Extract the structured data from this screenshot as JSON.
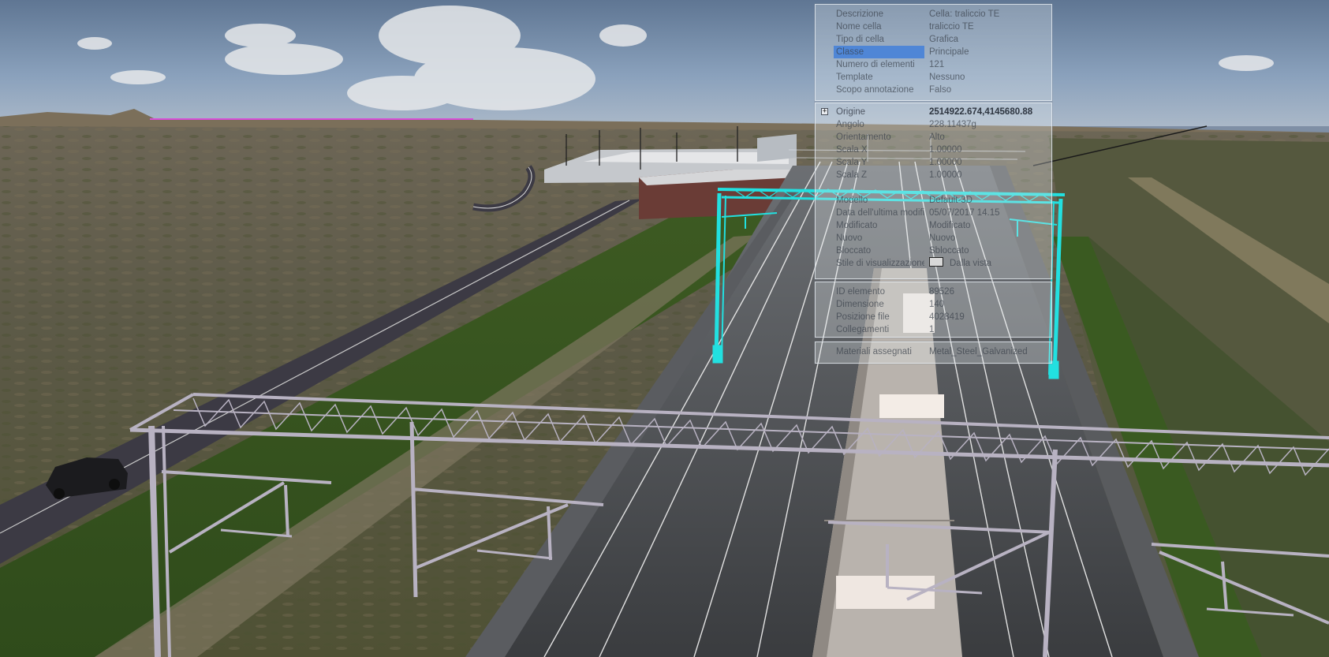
{
  "app": {
    "view": "3D viewport"
  },
  "info_panel": {
    "general": [
      {
        "label": "Descrizione",
        "value": "Cella: traliccio TE"
      },
      {
        "label": "Nome cella",
        "value": "traliccio TE"
      },
      {
        "label": "Tipo di cella",
        "value": "Grafica"
      },
      {
        "label": "Classe",
        "value": "Principale"
      },
      {
        "label": "Numero di elementi",
        "value": "121"
      },
      {
        "label": "Template",
        "value": "Nessuno"
      },
      {
        "label": "Scopo annotazione",
        "value": "Falso"
      }
    ],
    "geometry": [
      {
        "label": "Origine",
        "value": "2514922.674,4145680.88",
        "expander": "+"
      },
      {
        "label": "Angolo",
        "value": "228.11437g"
      },
      {
        "label": "Orientamento",
        "value": "Alto"
      },
      {
        "label": "Scala X",
        "value": "1.00000"
      },
      {
        "label": "Scala Y",
        "value": "1.00000"
      },
      {
        "label": "Scala Z",
        "value": "1.00000"
      },
      {
        "label": "",
        "value": ""
      },
      {
        "label": "Modello",
        "value": "Default-3D"
      },
      {
        "label": "Data dell'ultima modific",
        "value": "05/07/2017 14.15"
      },
      {
        "label": "Modificato",
        "value": "Modificato"
      },
      {
        "label": "Nuovo",
        "value": "Nuovo"
      },
      {
        "label": "Bloccato",
        "value": "Sbloccato"
      },
      {
        "label": "Stile di visualizzazione",
        "value": "Dalla vista",
        "swatch": true
      }
    ],
    "file": [
      {
        "label": "ID elemento",
        "value": "89526"
      },
      {
        "label": "Dimensione",
        "value": "140"
      },
      {
        "label": "Posizione file",
        "value": "4028419"
      },
      {
        "label": "Collegamenti",
        "value": "1"
      }
    ],
    "materials": [
      {
        "label": "Materiali assegnati",
        "value": "Metal_Steel_Galvanized"
      }
    ]
  },
  "colors": {
    "selection_highlight": "#22e0e0",
    "row_selected": "#4f86d6"
  }
}
